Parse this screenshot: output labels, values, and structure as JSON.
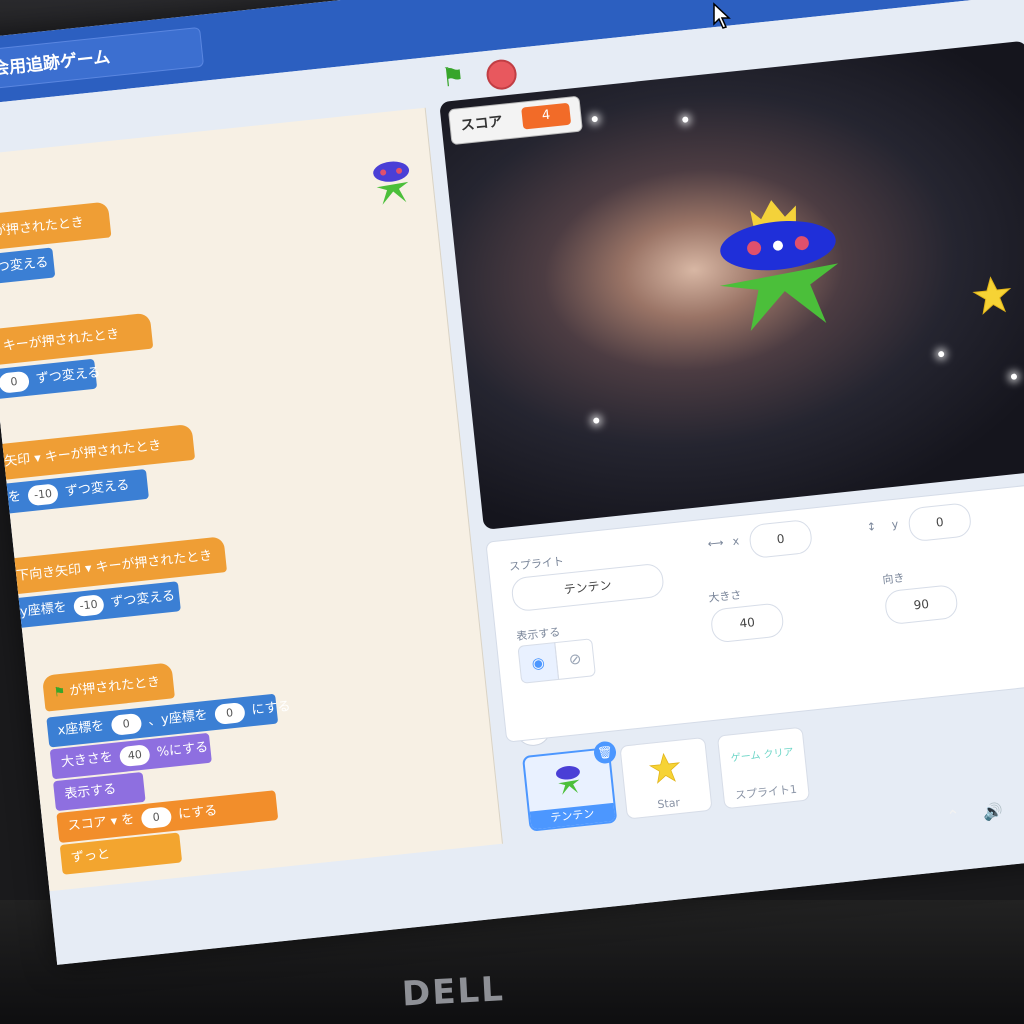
{
  "project": {
    "title": "会用追跡ゲーム"
  },
  "stage_monitor": {
    "label": "スコア",
    "value": "4"
  },
  "code_blocks": {
    "b1_hat": "ーが押されたとき",
    "b1_cmd": "ずつ変える",
    "b2_dropdown": "▾",
    "b2_hat": "キーが押されたとき",
    "b2_value": "0",
    "b2_cmd": "ずつ変える",
    "b3_dropdown": "矢印 ▾",
    "b3_hat": "キーが押されたとき",
    "b3_prefix": "を",
    "b3_value": "-10",
    "b3_cmd": "ずつ変える",
    "b4_dropdown": "下向き矢印 ▾",
    "b4_hat": "キーが押されたとき",
    "b4_prefix": "y座標を",
    "b4_value": "-10",
    "b4_cmd": "ずつ変える",
    "b5_hat": "が押されたとき",
    "b5_x_label": "x座標を",
    "b5_x_value": "0",
    "b5_y_label": "、y座標を",
    "b5_y_value": "0",
    "b5_suffix": "にする",
    "b5_size_label": "大きさを",
    "b5_size_value": "40",
    "b5_size_suffix": "%にする",
    "b5_show": "表示する",
    "b5_var_dropdown": "スコア ▾",
    "b5_var_to": "を",
    "b5_var_value": "0",
    "b5_var_suffix": "にする",
    "b5_forever": "ずっと"
  },
  "zoom": {
    "in": "⊕",
    "out": "⊖",
    "reset": "="
  },
  "sprite_info": {
    "sprite_label": "スプライト",
    "sprite_name": "テンテン",
    "x_label": "x",
    "x_value": "0",
    "y_label": "y",
    "y_value": "0",
    "show_label": "表示する",
    "size_label": "大きさ",
    "size_value": "40",
    "direction_label": "向き",
    "direction_value": "90"
  },
  "sprites": [
    {
      "name": "テンテン",
      "selected": true
    },
    {
      "name": "Star",
      "selected": false
    },
    {
      "name": "スプライト1",
      "selected": false,
      "thumb_text": "ゲーム クリア"
    }
  ],
  "colors": {
    "menubar": "#2c5fc0",
    "event": "#ef9e35",
    "motion": "#3b7fd4",
    "looks": "#8e6fe0",
    "variable": "#f28e2b",
    "accent": "#4c97ff"
  },
  "taskbar": {
    "tray_speaker": "🔊",
    "tray_cloud": "☁"
  }
}
